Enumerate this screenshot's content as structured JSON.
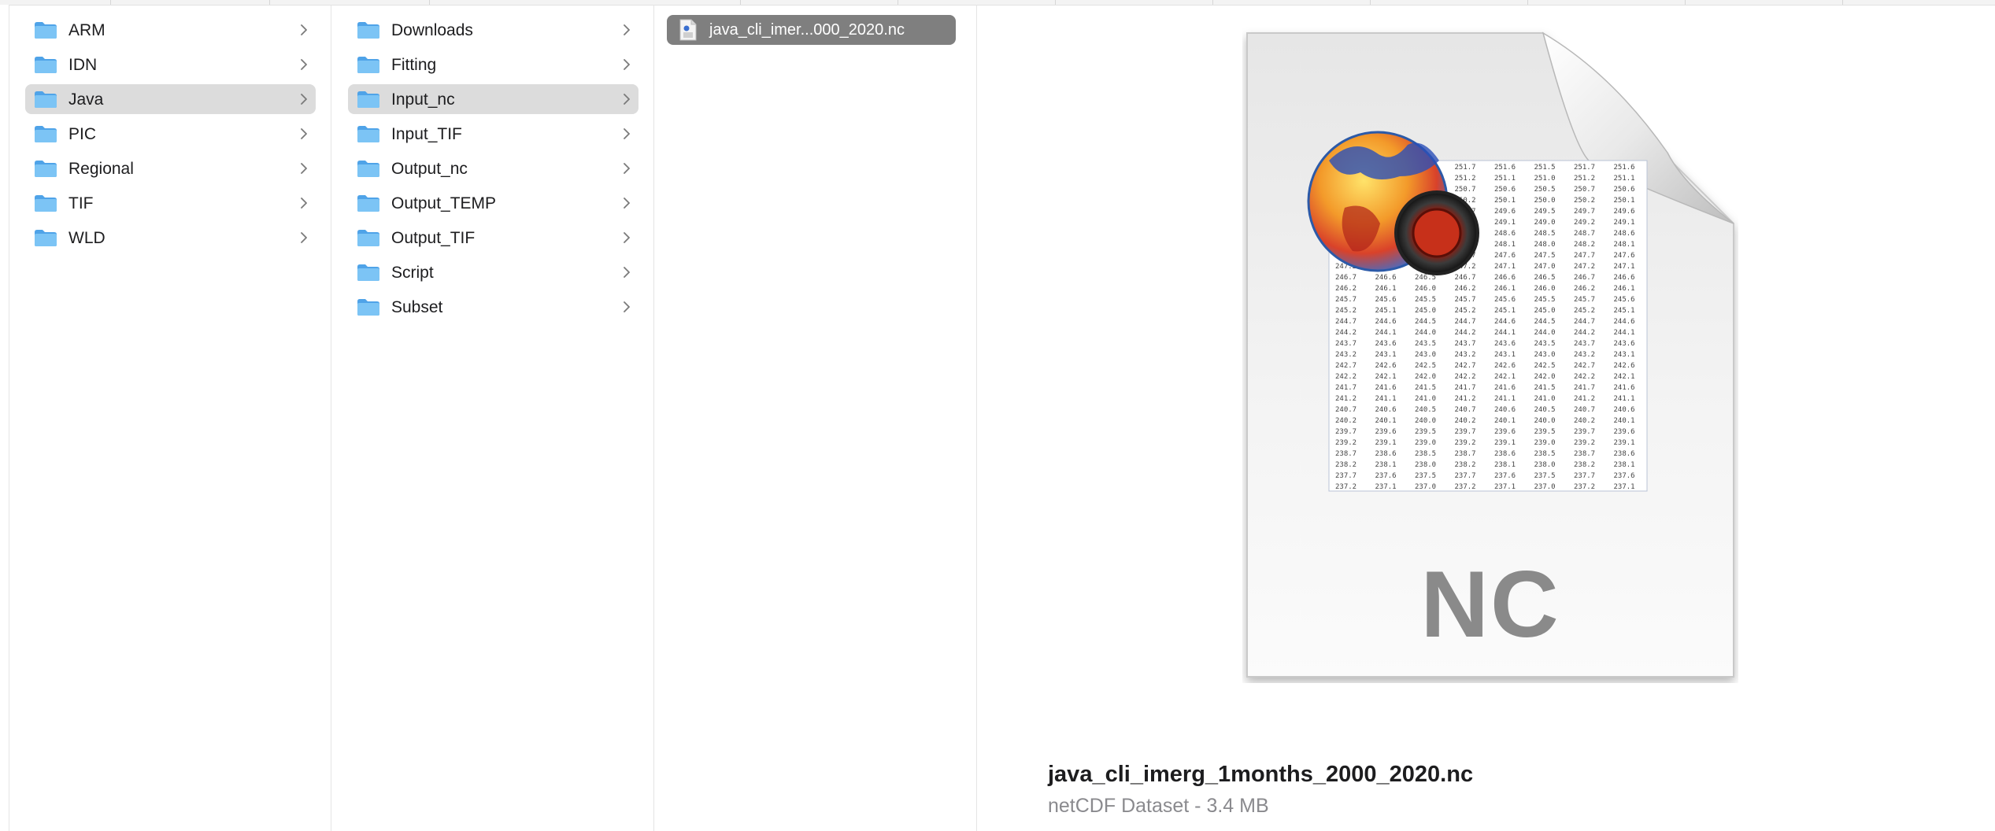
{
  "columns": {
    "col1": {
      "items": [
        {
          "label": "ARM"
        },
        {
          "label": "IDN"
        },
        {
          "label": "Java",
          "selected": true
        },
        {
          "label": "PIC"
        },
        {
          "label": "Regional"
        },
        {
          "label": "TIF"
        },
        {
          "label": "WLD"
        }
      ]
    },
    "col2": {
      "items": [
        {
          "label": "Downloads"
        },
        {
          "label": "Fitting"
        },
        {
          "label": "Input_nc",
          "selected": true
        },
        {
          "label": "Input_TIF"
        },
        {
          "label": "Output_nc"
        },
        {
          "label": "Output_TEMP"
        },
        {
          "label": "Output_TIF"
        },
        {
          "label": "Script"
        },
        {
          "label": "Subset"
        }
      ]
    },
    "col3": {
      "items": [
        {
          "label": "java_cli_imer...000_2020.nc",
          "selected": true
        }
      ]
    }
  },
  "preview": {
    "icon_badge": "NC",
    "file_name": "java_cli_imerg_1months_2000_2020.nc",
    "file_info": "netCDF Dataset - 3.4 MB"
  },
  "icons": {
    "folder": "folder-icon",
    "chevron": "chevron-right-icon",
    "file": "document-icon",
    "preview": "netcdf-document-icon"
  },
  "colors": {
    "folder_blue": "#5fb3ef",
    "selection_gray": "#dcdcdc",
    "selection_dark": "#7f7f7f"
  }
}
